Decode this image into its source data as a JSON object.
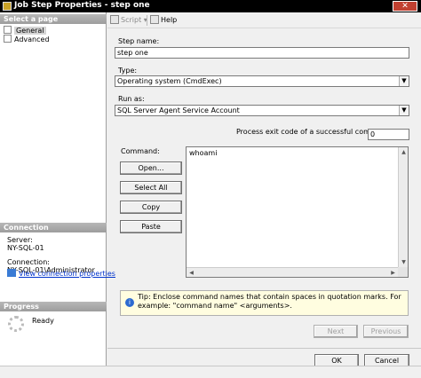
{
  "window": {
    "title": "Job Step Properties - step one",
    "close_label": "✕"
  },
  "left_pane": {
    "select_page_header": "Select a page",
    "pages": [
      {
        "label": "General",
        "icon": "page-icon"
      },
      {
        "label": "Advanced",
        "icon": "page-icon"
      }
    ],
    "connection_header": "Connection",
    "server_label": "Server:",
    "server_value": "NY-SQL-01",
    "connection_label": "Connection:",
    "connection_value": "NY-SQL-01\\Administrator",
    "view_connection_link": "View connection properties",
    "progress_header": "Progress",
    "progress_status": "Ready"
  },
  "toolbar": {
    "script_label": "Script",
    "script_dropdown": "▾",
    "help_label": "Help"
  },
  "form": {
    "step_name_label": "Step name:",
    "step_name_value": "step one",
    "type_label": "Type:",
    "type_value": "Operating system (CmdExec)",
    "run_as_label": "Run as:",
    "run_as_value": "SQL Server Agent Service Account",
    "exit_code_label": "Process exit code of a successful command:",
    "exit_code_value": "0",
    "command_label": "Command:",
    "command_value": "whoami",
    "buttons": {
      "open": "Open...",
      "select_all": "Select All",
      "copy": "Copy",
      "paste": "Paste"
    },
    "tip": "Tip: Enclose command names that contain spaces in quotation marks. For example: \"command name\" <arguments>.",
    "next_label": "Next",
    "previous_label": "Previous"
  },
  "footer": {
    "ok_label": "OK",
    "cancel_label": "Cancel"
  }
}
